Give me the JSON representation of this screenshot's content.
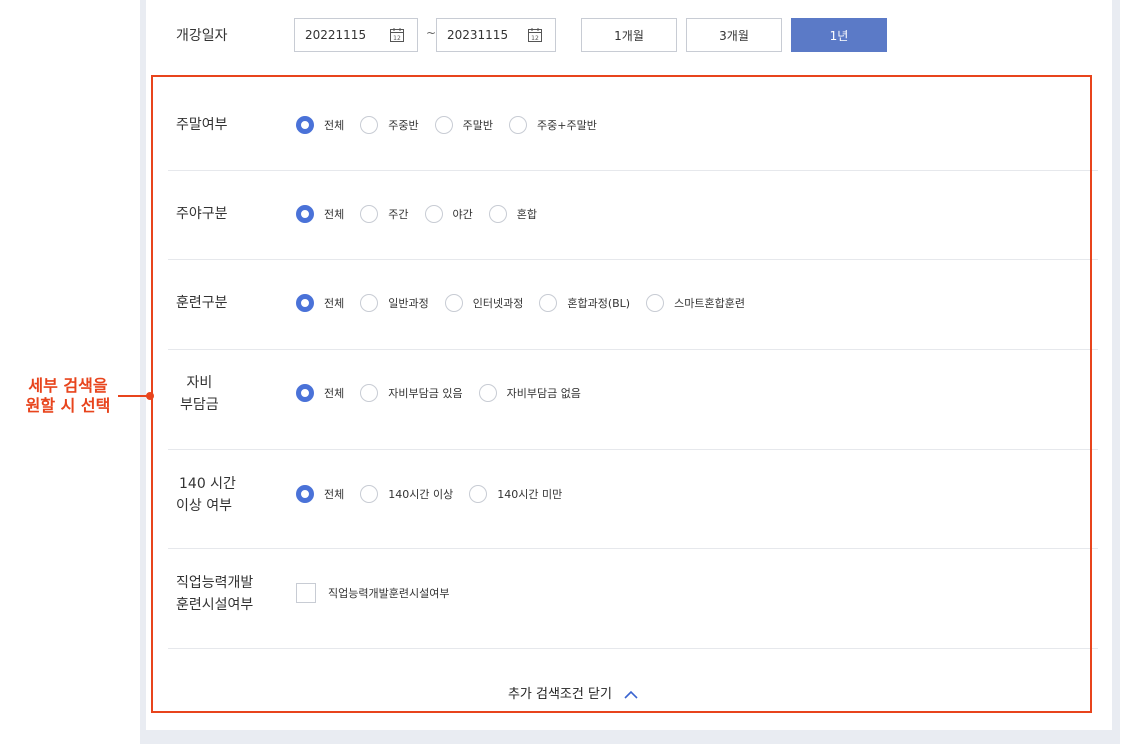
{
  "annotation": {
    "line1": "세부 검색을",
    "line2": "원할 시 선택"
  },
  "date_row": {
    "label": "개강일자",
    "start": "20221115",
    "end": "20231115",
    "tilde": "~",
    "periods": [
      "1개월",
      "3개월",
      "1년"
    ],
    "active_period": "1년"
  },
  "rows": [
    {
      "label_lines": [
        "주말여부"
      ],
      "options": [
        "전체",
        "주중반",
        "주말반",
        "주중+주말반"
      ],
      "selected": 0
    },
    {
      "label_lines": [
        "주야구분"
      ],
      "options": [
        "전체",
        "주간",
        "야간",
        "혼합"
      ],
      "selected": 0
    },
    {
      "label_lines": [
        "훈련구분"
      ],
      "options": [
        "전체",
        "일반과정",
        "인터넷과정",
        "혼합과정(BL)",
        "스마트혼합훈련"
      ],
      "selected": 0
    },
    {
      "label_lines": [
        "자비",
        "부담금"
      ],
      "options": [
        "전체",
        "자비부담금 있음",
        "자비부담금 없음"
      ],
      "selected": 0
    },
    {
      "label_lines": [
        "140 시간",
        "이상 여부"
      ],
      "options": [
        "전체",
        "140시간 이상",
        "140시간 미만"
      ],
      "selected": 0
    }
  ],
  "facility": {
    "label_lines": [
      "직업능력개발",
      "훈련시설여부"
    ],
    "checkbox_label": "직업능력개발훈련시설여부",
    "checked": false
  },
  "close_link": "추가 검색조건 닫기",
  "colors": {
    "accent": "#4a72d8",
    "active_button": "#5b7ac7",
    "highlight": "#e8441c"
  }
}
